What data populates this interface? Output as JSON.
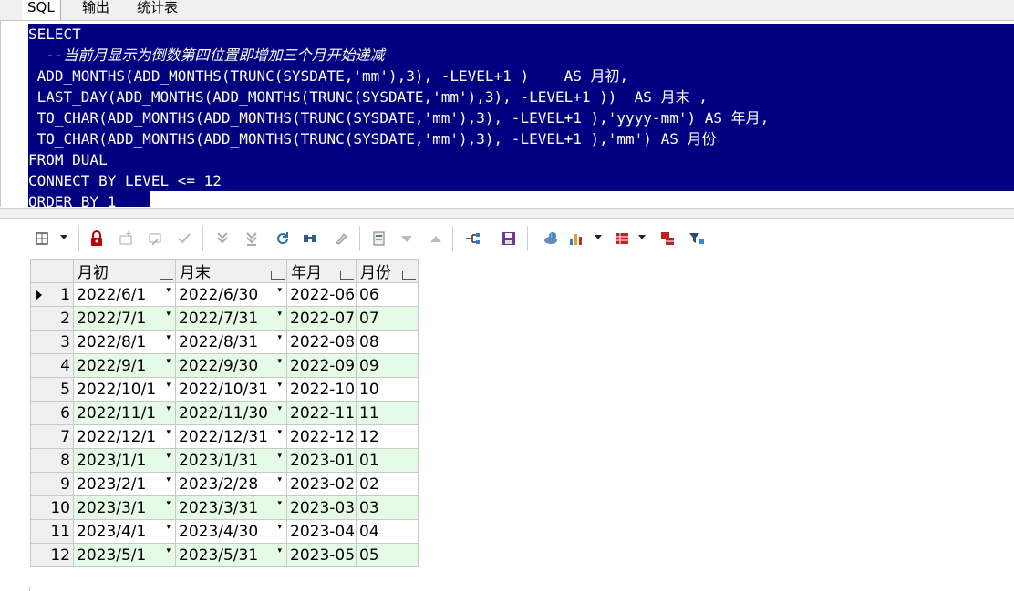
{
  "tabs": [
    {
      "label": "SQL",
      "active": true
    },
    {
      "label": "输出",
      "active": false
    },
    {
      "label": "统计表",
      "active": false
    }
  ],
  "editor": {
    "lines": [
      "SELECT",
      "  --当前月显示为倒数第四位置即增加三个月开始递减",
      " ADD_MONTHS(ADD_MONTHS(TRUNC(SYSDATE,'mm'),3), -LEVEL+1 )    AS 月初,",
      " LAST_DAY(ADD_MONTHS(ADD_MONTHS(TRUNC(SYSDATE,'mm'),3), -LEVEL+1 ))  AS 月末 ,",
      " TO_CHAR(ADD_MONTHS(ADD_MONTHS(TRUNC(SYSDATE,'mm'),3), -LEVEL+1 ),'yyyy-mm') AS 年月,",
      " TO_CHAR(ADD_MONTHS(ADD_MONTHS(TRUNC(SYSDATE,'mm'),3), -LEVEL+1 ),'mm') AS 月份",
      "FROM DUAL",
      "CONNECT BY LEVEL <= 12",
      "ORDER BY 1"
    ],
    "selection_color": "#000080"
  },
  "toolbar": {
    "icons": [
      "grid-options-icon",
      "lock-icon",
      "add-record-icon",
      "delete-record-icon",
      "post-edit-icon",
      "last-record-icon",
      "fetch-all-icon",
      "refresh-icon",
      "find-icon",
      "clear-icon",
      "query-by-example-icon",
      "sort-desc-icon",
      "sort-asc-icon",
      "link-icon",
      "save-icon",
      "export-icon",
      "chart-icon",
      "table-view-icon",
      "compare-icon",
      "filter-icon"
    ]
  },
  "grid": {
    "columns": [
      "月初",
      "月末",
      "年月",
      "月份"
    ],
    "rows": [
      {
        "n": "1",
        "c": [
          "2022/6/1",
          "2022/6/30",
          "2022-06",
          "06"
        ]
      },
      {
        "n": "2",
        "c": [
          "2022/7/1",
          "2022/7/31",
          "2022-07",
          "07"
        ]
      },
      {
        "n": "3",
        "c": [
          "2022/8/1",
          "2022/8/31",
          "2022-08",
          "08"
        ]
      },
      {
        "n": "4",
        "c": [
          "2022/9/1",
          "2022/9/30",
          "2022-09",
          "09"
        ]
      },
      {
        "n": "5",
        "c": [
          "2022/10/1",
          "2022/10/31",
          "2022-10",
          "10"
        ]
      },
      {
        "n": "6",
        "c": [
          "2022/11/1",
          "2022/11/30",
          "2022-11",
          "11"
        ]
      },
      {
        "n": "7",
        "c": [
          "2022/12/1",
          "2022/12/31",
          "2022-12",
          "12"
        ]
      },
      {
        "n": "8",
        "c": [
          "2023/1/1",
          "2023/1/31",
          "2023-01",
          "01"
        ]
      },
      {
        "n": "9",
        "c": [
          "2023/2/1",
          "2023/2/28",
          "2023-02",
          "02"
        ]
      },
      {
        "n": "10",
        "c": [
          "2023/3/1",
          "2023/3/31",
          "2023-03",
          "03"
        ]
      },
      {
        "n": "11",
        "c": [
          "2023/4/1",
          "2023/4/30",
          "2023-04",
          "04"
        ]
      },
      {
        "n": "12",
        "c": [
          "2023/5/1",
          "2023/5/31",
          "2023-05",
          "05"
        ]
      }
    ],
    "alt_row_color": "#e6fbe6"
  }
}
